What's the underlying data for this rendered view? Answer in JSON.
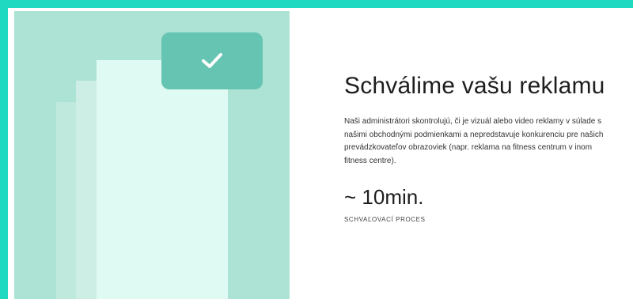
{
  "colors": {
    "frame": "#1fd9c0",
    "illustration_bg": "#ade3d5",
    "badge": "#65c4b2",
    "doc_front": "#defaf3"
  },
  "illustration": {
    "badge_icon": "check-icon"
  },
  "title": "Schválime vašu reklamu",
  "description": "Naši administrátori skontrolujú, či je vizuál alebo video reklamy v súlade s našimi obchodnými podmienkami a nepredstavuje konkurenciu pre našich prevádzkovateľov obrazoviek (napr. reklama na fitness centrum v inom fitness centre).",
  "stat": {
    "value": "~ 10min.",
    "label": "SCHVAĽOVACÍ PROCES"
  }
}
